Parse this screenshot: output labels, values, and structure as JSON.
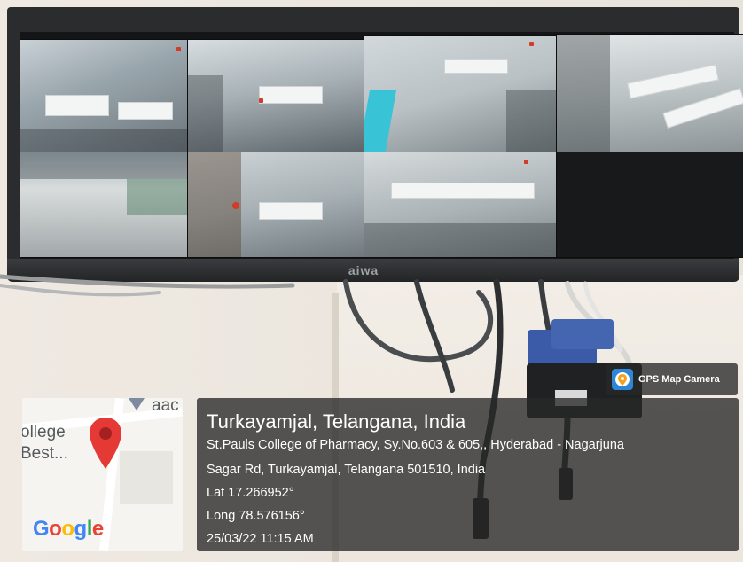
{
  "monitor": {
    "brand": "aiwa"
  },
  "map": {
    "label_top": "aac",
    "label_line1": "ollege",
    "label_line2": "Best...",
    "logo": "Google",
    "pin_icon": "location-pin-icon"
  },
  "badge": {
    "text": "GPS Map Camera",
    "icon": "gps-camera-icon"
  },
  "info": {
    "title": "Turkayamjal, Telangana, India",
    "address_line1": "St.Pauls College of Pharmacy, Sy.No.603 & 605,, Hyderabad - Nagarjuna",
    "address_line2": "Sagar Rd, Turkayamjal, Telangana 501510, India",
    "lat": "Lat 17.266952°",
    "long": "Long 78.576156°",
    "datetime": "25/03/22 11:15 AM"
  },
  "colors": {
    "panel_bg": "#282828",
    "pin": "#e53935",
    "badge_icon": "#2f86d6"
  }
}
